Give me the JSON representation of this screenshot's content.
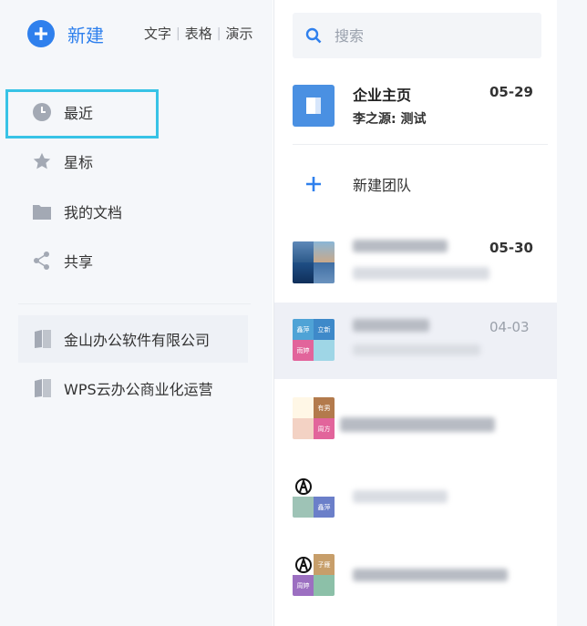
{
  "sidebar": {
    "new_label": "新建",
    "doc_types": [
      "文字",
      "表格",
      "演示"
    ],
    "nav": [
      {
        "label": "最近",
        "icon": "clock-icon"
      },
      {
        "label": "星标",
        "icon": "star-icon"
      },
      {
        "label": "我的文档",
        "icon": "folder-icon"
      },
      {
        "label": "共享",
        "icon": "share-icon"
      }
    ],
    "orgs": [
      {
        "label": "金山办公软件有限公司",
        "icon": "book-icon"
      },
      {
        "label": "WPS云办公商业化运营",
        "icon": "book-icon"
      }
    ]
  },
  "search": {
    "placeholder": "搜索",
    "icon": "search-icon"
  },
  "company": {
    "title": "企业主页",
    "subtitle": "李之源: 测试",
    "date": "05-29"
  },
  "new_team": {
    "label": "新建团队"
  },
  "chats": [
    {
      "date": "05-30",
      "avatar_labels": []
    },
    {
      "date": "04-03",
      "avatar_labels": [
        "鑫萍",
        "立新",
        "雨婷",
        ""
      ]
    },
    {
      "date": "",
      "avatar_labels": [
        "",
        "有男",
        "",
        "周方"
      ]
    },
    {
      "date": "",
      "avatar_labels": [
        "",
        "",
        "",
        "鑫萍"
      ]
    },
    {
      "date": "",
      "avatar_labels": [
        "",
        "子雁",
        "周婷",
        ""
      ]
    }
  ],
  "colors": {
    "accent": "#2f80ed",
    "highlight": "#38c3e6",
    "company_icon": "#4a90e2"
  }
}
